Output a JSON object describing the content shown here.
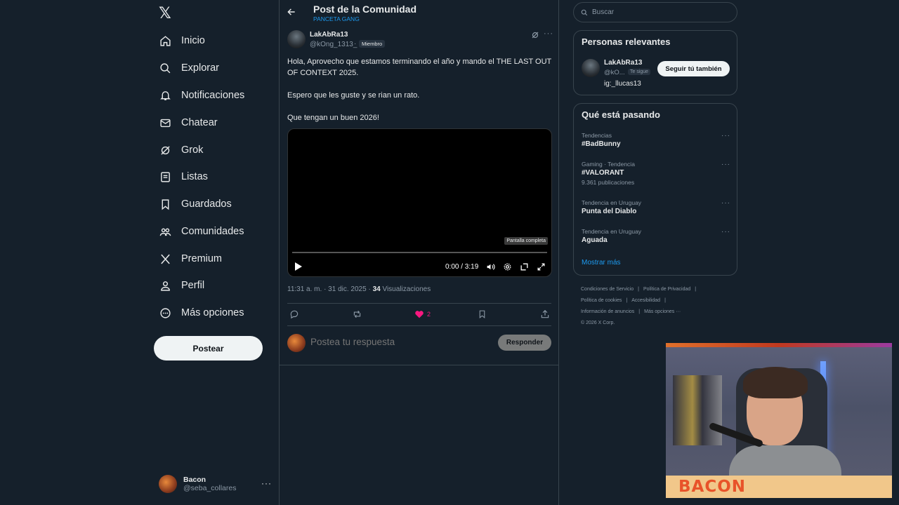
{
  "sidebar": {
    "logo": "𝕏",
    "items": [
      {
        "label": "Inicio",
        "icon": "home-icon"
      },
      {
        "label": "Explorar",
        "icon": "search-icon"
      },
      {
        "label": "Notificaciones",
        "icon": "bell-icon"
      },
      {
        "label": "Chatear",
        "icon": "mail-icon"
      },
      {
        "label": "Grok",
        "icon": "grok-icon"
      },
      {
        "label": "Listas",
        "icon": "list-icon"
      },
      {
        "label": "Guardados",
        "icon": "bookmark-icon"
      },
      {
        "label": "Comunidades",
        "icon": "communities-icon"
      },
      {
        "label": "Premium",
        "icon": "x-icon"
      },
      {
        "label": "Perfil",
        "icon": "user-icon"
      },
      {
        "label": "Más opciones",
        "icon": "more-circle-icon"
      }
    ],
    "post_label": "Postear",
    "account": {
      "name": "Bacon",
      "handle": "@seba_collares",
      "more": "···"
    }
  },
  "header": {
    "title": "Post de la Comunidad",
    "subtitle": "PANCETA GANG"
  },
  "post": {
    "author_name": "LakAbRa13",
    "author_handle": "@kOng_1313_",
    "author_dot": "·",
    "author_badge": "Miembro",
    "more": "···",
    "paragraphs": [
      "Hola, Aprovecho que estamos terminando el año y mando el THE LAST OUT OF CONTEXT 2025.",
      "Espero que les guste y se rian un rato.",
      "Que tengan un buen 2026!"
    ],
    "video": {
      "tooltip": "Pantalla completa",
      "time": "0:00 / 3:19",
      "progress": 0
    },
    "timestamp": "11:31 a. m. · 31 dic. 2025 · ",
    "views_count": "34",
    "views_label": " Visualizaciones",
    "likes": "2"
  },
  "reply": {
    "placeholder": "Postea tu respuesta",
    "button": "Responder"
  },
  "right": {
    "search_placeholder": "Buscar",
    "relevant": {
      "title": "Personas relevantes",
      "name": "LakAbRa13",
      "handle": "@kO...",
      "badge": "Te sigue",
      "bio": "ig:_llucas13",
      "follow": "Seguir tú también"
    },
    "trends": {
      "title": "Qué está pasando",
      "items": [
        {
          "context": "Tendencias",
          "title": "#BadBunny",
          "count": ""
        },
        {
          "context": "Gaming · Tendencia",
          "title": "#VALORANT",
          "count": "9.361 publicaciones"
        },
        {
          "context": "Tendencia en Uruguay",
          "title": "Punta del Diablo",
          "count": ""
        },
        {
          "context": "Tendencia en Uruguay",
          "title": "Aguada",
          "count": ""
        }
      ],
      "more": "···",
      "show_more": "Mostrar más"
    },
    "footer": {
      "line1": [
        "Condiciones de Servicio",
        "|",
        "Política de Privacidad",
        "|"
      ],
      "line2": [
        "Política de cookies",
        "|",
        "Accesibilidad",
        "|"
      ],
      "line3": [
        "Información de anuncios",
        "|",
        "Más opciones ···"
      ],
      "copyright": "© 2026 X Corp."
    }
  },
  "webcam": {
    "banner": "BACON"
  },
  "colors": {
    "accent": "#1d9bf0",
    "background": "#15202b",
    "like": "#f91880",
    "border": "#38444d"
  }
}
